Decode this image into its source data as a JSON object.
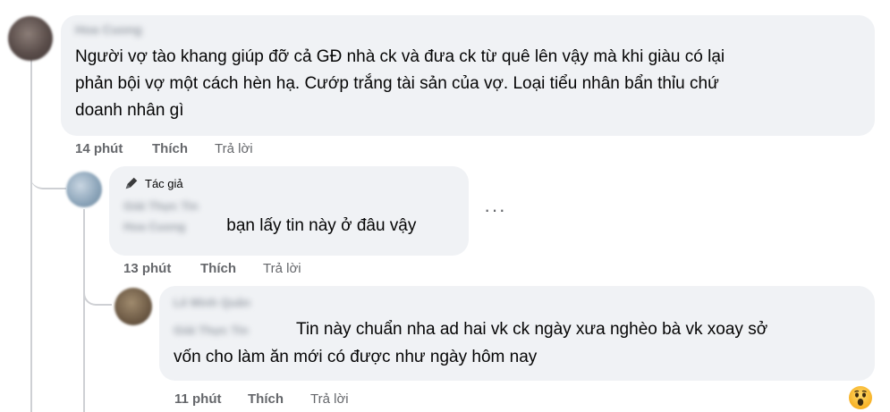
{
  "comments": [
    {
      "author_blurred": "Hoa Cuong",
      "text": "Người vợ tào khang giúp đỡ cả GĐ nhà ck và đưa ck từ quê lên vậy mà khi giàu có lại phản bội vợ một cách hèn hạ. Cướp trắng tài sản của vợ. Loại tiểu nhân bẩn thỉu chứ doanh nhân gì",
      "line1": "Người vợ tào khang giúp đỡ cả GĐ nhà ck và đưa ck từ quê lên vậy mà khi giàu có lại",
      "line2": "phản bội vợ một cách hèn hạ. Cướp trắng tài sản của vợ. Loại tiểu nhân bẩn thỉu chứ",
      "line3": "doanh nhân gì",
      "time": "14 phút",
      "like": "Thích",
      "reply": "Trả lời"
    },
    {
      "badge": "Tác giả",
      "author_blurred": "Giải Thực Tin",
      "mention_blurred": "Hoa Cuong",
      "text": "bạn lấy tin này ở đâu vậy",
      "time": "13 phút",
      "like": "Thích",
      "reply": "Trả lời",
      "more": "···"
    },
    {
      "author_blurred": "Lê Minh Quân",
      "mention_blurred": "Giải Thực Tin",
      "line1": "Tin này chuẩn nha ad hai vk ck ngày xưa nghèo bà vk xoay sở",
      "line2": "vốn cho làm ăn mới có được như ngày hôm nay",
      "time": "11 phút",
      "like": "Thích",
      "reply": "Trả lời",
      "reaction": "wow-reaction-icon"
    }
  ],
  "colors": {
    "bubble": "#f0f2f5",
    "meta": "#65676b",
    "line": "#ced0d4",
    "text": "#050505"
  }
}
